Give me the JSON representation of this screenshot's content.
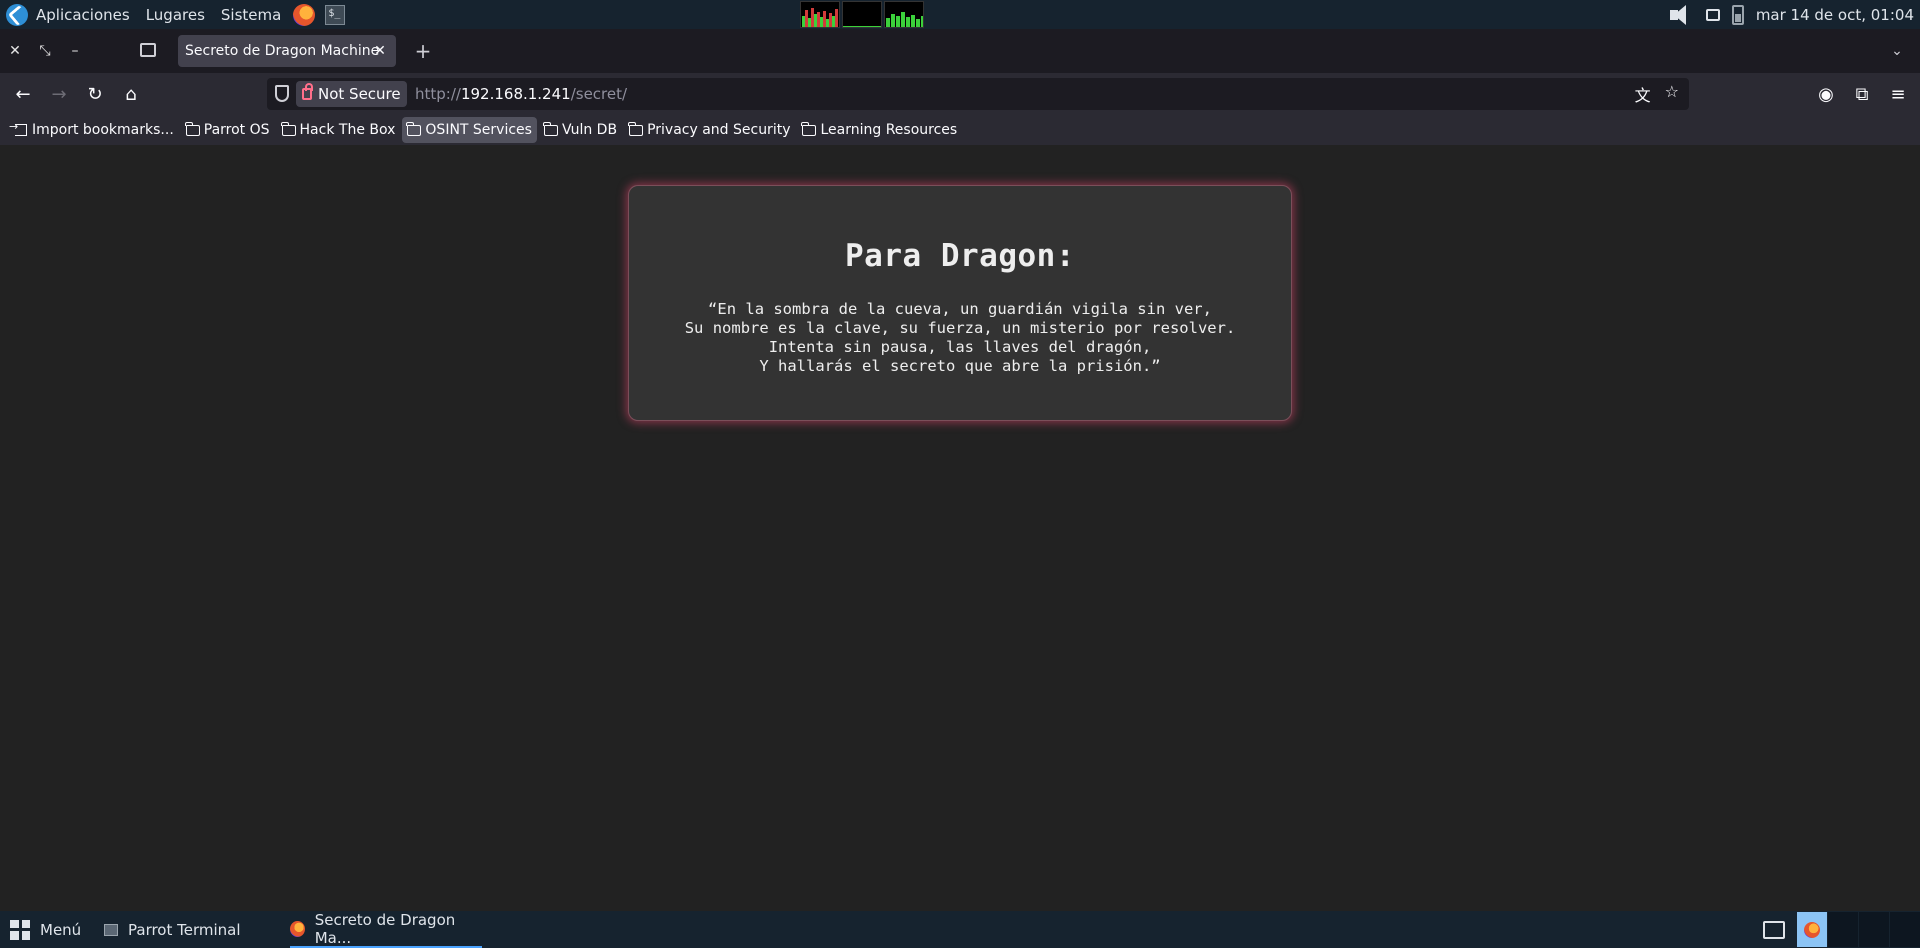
{
  "top_panel": {
    "menus": [
      "Aplicaciones",
      "Lugares",
      "Sistema"
    ],
    "clock": "mar 14 de oct, 01:04"
  },
  "browser": {
    "tab_title": "Secreto de Dragon Machine",
    "url_security": "Not Secure",
    "url_scheme": "http://",
    "url_host": "192.168.1.241",
    "url_path": "/secret/",
    "bookmarks": [
      "Import bookmarks...",
      "Parrot OS",
      "Hack The Box",
      "OSINT Services",
      "Vuln DB",
      "Privacy and Security",
      "Learning Resources"
    ]
  },
  "page": {
    "heading": "Para Dragon:",
    "poem": [
      "“En la sombra de la cueva, un guardián vigila sin ver,",
      "Su nombre es la clave, su fuerza, un misterio por resolver.",
      "Intenta sin pausa, las llaves del dragón,",
      "Y hallarás el secreto que abre la prisión.”"
    ]
  },
  "taskbar": {
    "menu_label": "Menú",
    "tasks": [
      "Parrot Terminal",
      "Secreto de Dragon Ma..."
    ]
  },
  "colors": {
    "card_glow": "#d64468",
    "page_bg": "#222222",
    "card_bg": "#333333"
  }
}
